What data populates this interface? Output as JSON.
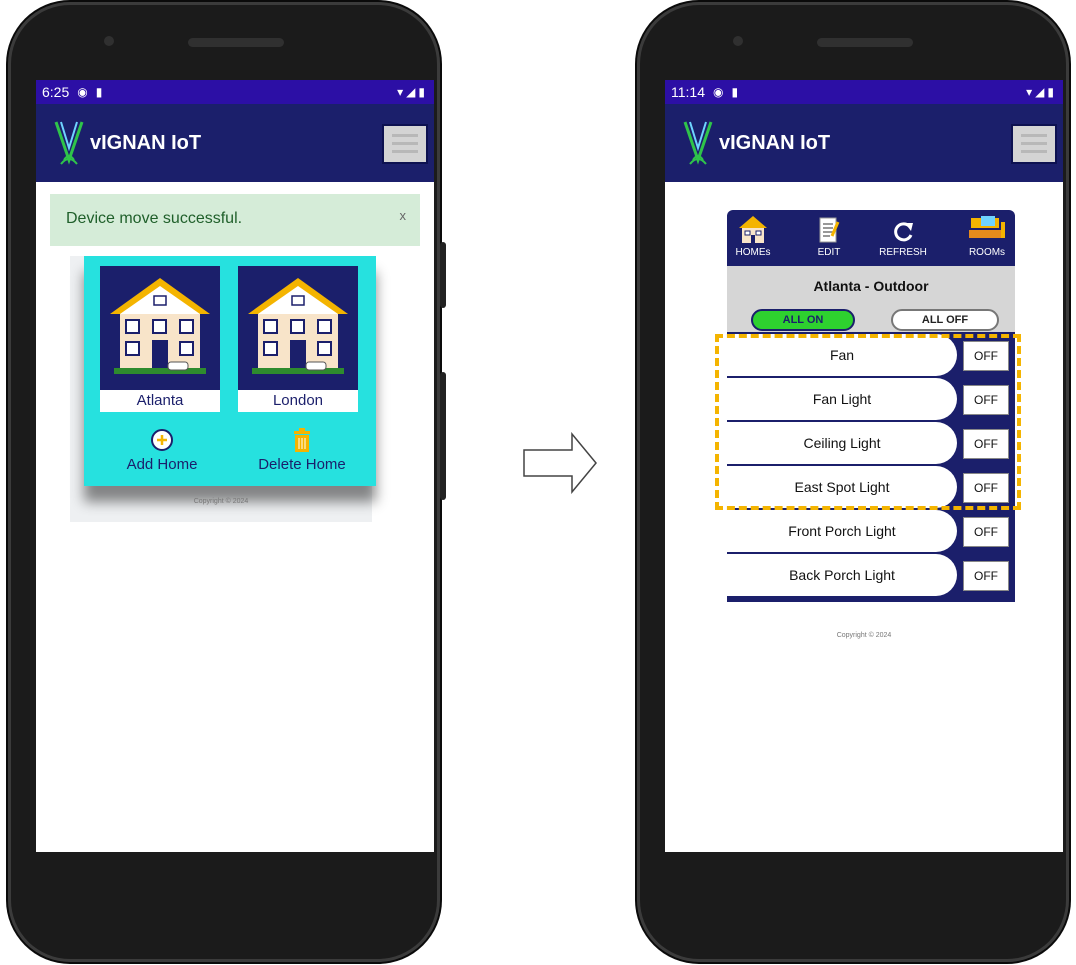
{
  "left_phone": {
    "status_time": "6:25",
    "brand": "vIGNAN IoT",
    "alert": {
      "message": "Device move successful.",
      "close": "x"
    },
    "homes": [
      {
        "name": "Atlanta"
      },
      {
        "name": "London"
      }
    ],
    "actions": {
      "add": "Add Home",
      "delete": "Delete Home"
    },
    "copyright": "Copyright © 2024"
  },
  "right_phone": {
    "status_time": "11:14",
    "brand": "vIGNAN IoT",
    "toolbar": {
      "homes": "HOMEs",
      "edit": "EDIT",
      "refresh": "REFRESH",
      "rooms": "ROOMs"
    },
    "room_title": "Atlanta - Outdoor",
    "all_on": "ALL ON",
    "all_off": "ALL OFF",
    "devices": [
      {
        "name": "Fan",
        "state": "OFF"
      },
      {
        "name": "Fan Light",
        "state": "OFF"
      },
      {
        "name": "Ceiling Light",
        "state": "OFF"
      },
      {
        "name": "East Spot Light",
        "state": "OFF"
      },
      {
        "name": "Front Porch Light",
        "state": "OFF"
      },
      {
        "name": "Back Porch Light",
        "state": "OFF"
      }
    ],
    "copyright": "Copyright © 2024"
  },
  "colors": {
    "status_bar": "#2c0fa5",
    "app_bar": "#1b1f6b",
    "homes_panel": "#26e1df",
    "alert_bg": "#d5ecd8",
    "all_on": "#2ed12f",
    "highlight": "#f4b400"
  }
}
